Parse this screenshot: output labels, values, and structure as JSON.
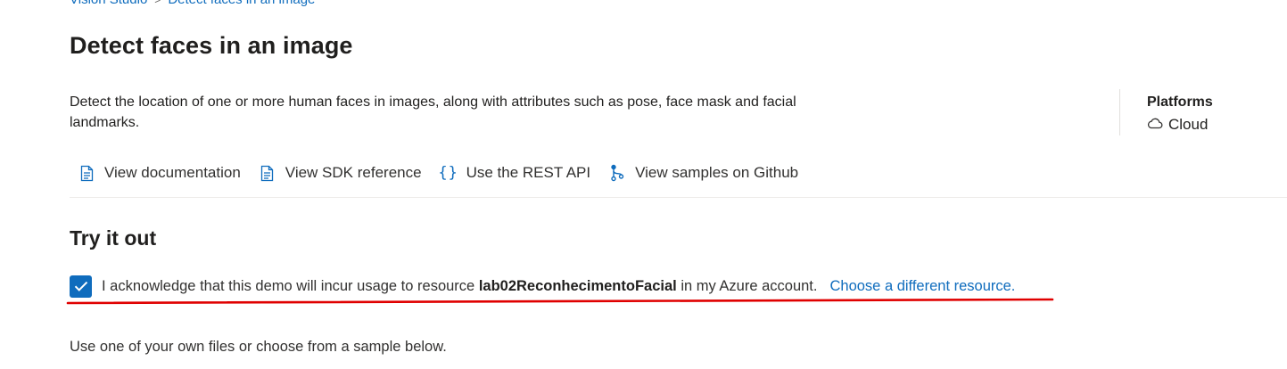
{
  "breadcrumb": {
    "root": "Vision Studio",
    "separator": ">",
    "current": "Detect faces in an image"
  },
  "page": {
    "title": "Detect faces in an image",
    "description_line1": "Detect the location of one or more human faces in images, along with attributes such as pose, face mask and facial",
    "description_line2": "landmarks."
  },
  "platforms": {
    "title": "Platforms",
    "value": "Cloud",
    "icon": "cloud-icon"
  },
  "resource_links": [
    {
      "label": "View documentation",
      "icon": "document-icon"
    },
    {
      "label": "View SDK reference",
      "icon": "document-icon"
    },
    {
      "label": "Use the REST API",
      "icon": "braces-icon"
    },
    {
      "label": "View samples on Github",
      "icon": "branch-icon"
    }
  ],
  "try_it_out": {
    "title": "Try it out",
    "ack_checked": true,
    "ack_prefix": "I acknowledge that this demo will incur usage to resource ",
    "ack_resource": "lab02ReconhecimentoFacial",
    "ack_suffix": " in my Azure account.",
    "choose_link": "Choose a different resource.",
    "files_text": "Use one of your own files or choose from a sample below."
  },
  "colors": {
    "accent": "#0f6cbd",
    "annotation": "#e00000"
  }
}
